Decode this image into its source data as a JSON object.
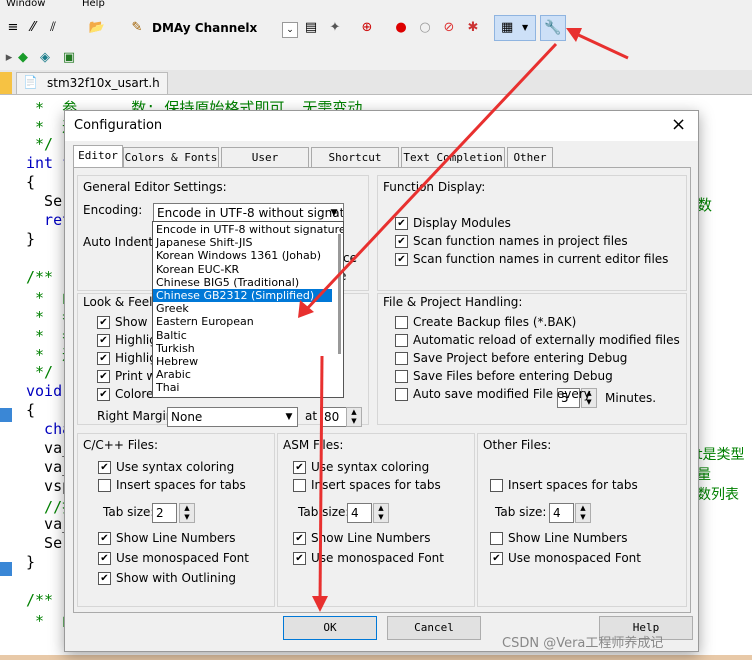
{
  "menubar": {
    "items": [
      "Window",
      "Help"
    ]
  },
  "toolbar": {
    "target_name": "DMAy Channelx"
  },
  "file_tab": {
    "label": "stm32f10x_usart.h"
  },
  "editor_lines": [
    {
      "text": " *  参      数: 保持原始格式即可, 无需变动",
      "cls": "cm"
    },
    {
      "text": " *  返",
      "cls": "cm"
    },
    {
      "text": " */",
      "cls": "cm"
    },
    {
      "text": "int fp",
      "cls": "kw"
    },
    {
      "text": "{",
      "cls": ""
    },
    {
      "text": "  Seri",
      "cls": ""
    },
    {
      "text": "  retu",
      "cls": "kw"
    },
    {
      "text": "}",
      "cls": ""
    },
    {
      "text": "",
      "cls": ""
    },
    {
      "text": "/**",
      "cls": "cm"
    },
    {
      "text": " *  函",
      "cls": "cm"
    },
    {
      "text": " *  参",
      "cls": "cm"
    },
    {
      "text": " *  参",
      "cls": "cm"
    },
    {
      "text": " *  返",
      "cls": "cm"
    },
    {
      "text": " */",
      "cls": "cm"
    },
    {
      "text": "void S",
      "cls": "kw"
    },
    {
      "text": "{",
      "cls": ""
    },
    {
      "text": "  char",
      "cls": "kw"
    },
    {
      "text": "  va_l",
      "cls": ""
    },
    {
      "text": "  va_s",
      "cls": ""
    },
    {
      "text": "  vspr",
      "cls": ""
    },
    {
      "text": "  //打",
      "cls": "cm"
    },
    {
      "text": "  va_e",
      "cls": ""
    },
    {
      "text": "  Seri",
      "cls": ""
    },
    {
      "text": "}",
      "cls": ""
    },
    {
      "text": "",
      "cls": ""
    },
    {
      "text": "/**",
      "cls": "cm"
    },
    {
      "text": " *  函",
      "cls": "cm"
    }
  ],
  "editor_right": {
    "a": "数",
    "b": "t是类型",
    "c": "量",
    "d": "数列表"
  },
  "dialog": {
    "title": "Configuration",
    "close_glyph": "×",
    "tabs": [
      "Editor",
      "Colors & Fonts",
      "User Keywords",
      "Shortcut Keys",
      "Text Completion",
      "Other"
    ],
    "general": {
      "label": "General Editor Settings:",
      "encoding_label": "Encoding:",
      "encoding_value": "Encode in UTF-8 without signature",
      "auto_indent_label": "Auto Indent:",
      "auto_indent_partial_a": "ce",
      "auto_indent_partial_b": "e"
    },
    "encoding_options": [
      {
        "label": "Encode in UTF-8 without signature",
        "selected": false
      },
      {
        "label": "Japanese Shift-JIS",
        "selected": false
      },
      {
        "label": "Korean Windows 1361 (Johab)",
        "selected": false
      },
      {
        "label": "Korean EUC-KR",
        "selected": false
      },
      {
        "label": "Chinese BIG5 (Traditional)",
        "selected": false
      },
      {
        "label": "Chinese GB2312 (Simplified)",
        "selected": true
      },
      {
        "label": "Greek",
        "selected": false
      },
      {
        "label": "Eastern European",
        "selected": false
      },
      {
        "label": "Baltic",
        "selected": false
      },
      {
        "label": "Turkish",
        "selected": false
      },
      {
        "label": "Hebrew",
        "selected": false
      },
      {
        "label": "Arabic",
        "selected": false
      },
      {
        "label": "Thai",
        "selected": false
      }
    ],
    "function_display": {
      "label": "Function Display:",
      "items": [
        {
          "label": "Display Modules",
          "checked": true
        },
        {
          "label": "Scan function names in project files",
          "checked": true
        },
        {
          "label": "Scan function names in current editor files",
          "checked": true
        }
      ]
    },
    "look_feel": {
      "label": "Look & Feel:",
      "items": [
        {
          "label": "Show M",
          "checked": true
        },
        {
          "label": "Highligh",
          "checked": true
        },
        {
          "label": "Highligh",
          "checked": true
        },
        {
          "label": "Print wit",
          "checked": true
        },
        {
          "label": "Colored Status Tabs",
          "checked": true
        }
      ],
      "right_margin_label": "Right Margin:",
      "right_margin_value": "None",
      "at_label": "at",
      "at_value": "80"
    },
    "file_project": {
      "label": "File & Project Handling:",
      "items": [
        {
          "label": "Create Backup files (*.BAK)",
          "checked": false
        },
        {
          "label": "Automatic reload of externally modified files",
          "checked": false
        },
        {
          "label": "Save Project before entering Debug",
          "checked": false
        },
        {
          "label": "Save Files before entering Debug",
          "checked": false
        },
        {
          "label": "Auto save modified File every",
          "checked": false
        }
      ],
      "autosave_value": "5",
      "minutes_label": "Minutes."
    },
    "cpp_files": {
      "label": "C/C++ Files:",
      "syntax": {
        "label": "Use syntax coloring",
        "checked": true
      },
      "spaces": {
        "label": "Insert spaces for tabs",
        "checked": false
      },
      "tab_size_label": "Tab size:",
      "tab_size": "2",
      "line_numbers": {
        "label": "Show Line Numbers",
        "checked": true
      },
      "monospace": {
        "label": "Use monospaced Font",
        "checked": true
      },
      "outlining": {
        "label": "Show with Outlining",
        "checked": true
      }
    },
    "asm_files": {
      "label": "ASM Files:",
      "syntax": {
        "label": "Use syntax coloring",
        "checked": true
      },
      "spaces": {
        "label": "Insert spaces for tabs",
        "checked": false
      },
      "tab_size_label": "Tab size:",
      "tab_size": "4",
      "line_numbers": {
        "label": "Show Line Numbers",
        "checked": true
      },
      "monospace": {
        "label": "Use monospaced Font",
        "checked": true
      }
    },
    "other_files": {
      "label": "Other Files:",
      "spaces": {
        "label": "Insert spaces for tabs",
        "checked": false
      },
      "tab_size_label": "Tab size:",
      "tab_size": "4",
      "line_numbers": {
        "label": "Show Line Numbers",
        "checked": false
      },
      "monospace": {
        "label": "Use monospaced Font",
        "checked": true
      }
    },
    "buttons": {
      "ok": "OK",
      "cancel": "Cancel",
      "help": "Help"
    }
  },
  "watermark": "CSDN @Vera工程师养成记",
  "colors": {
    "annotation_arrow": "#e8302f",
    "selection": "#0078d7",
    "comment": "#008000",
    "keyword": "#0000c0"
  }
}
